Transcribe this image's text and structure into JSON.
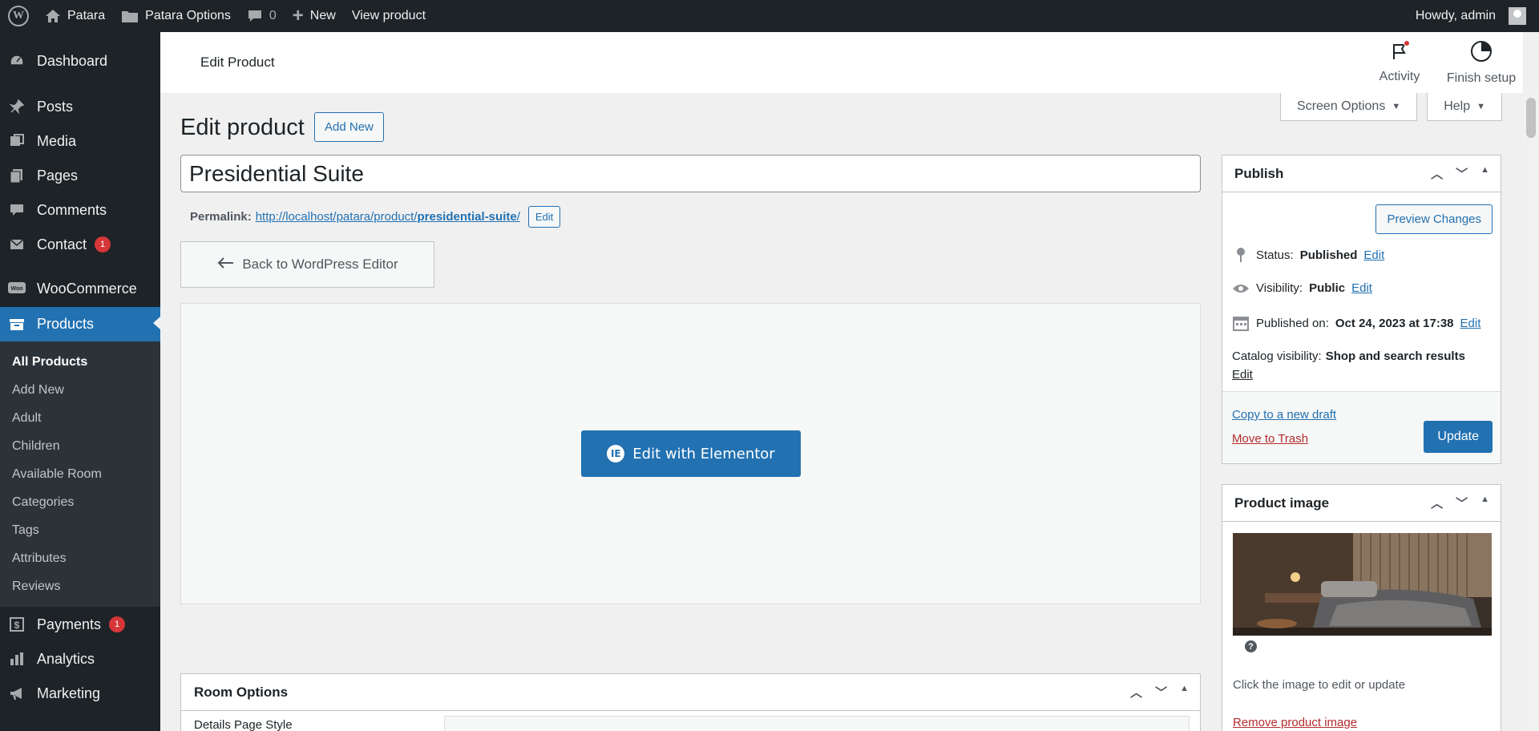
{
  "adminbar": {
    "site_name": "Patara",
    "options_label": "Patara Options",
    "comments_count": "0",
    "new_label": "New",
    "view_label": "View product",
    "howdy": "Howdy, admin"
  },
  "sidebar": {
    "items": [
      {
        "label": "Dashboard",
        "icon": "dashboard-icon"
      },
      {
        "label": "Posts",
        "icon": "pin-icon"
      },
      {
        "label": "Media",
        "icon": "media-icon"
      },
      {
        "label": "Pages",
        "icon": "pages-icon"
      },
      {
        "label": "Comments",
        "icon": "comment-icon"
      },
      {
        "label": "Contact",
        "icon": "mail-icon",
        "badge": "1"
      },
      {
        "label": "WooCommerce",
        "icon": "woo-icon"
      },
      {
        "label": "Products",
        "icon": "archive-icon"
      },
      {
        "label": "Payments",
        "icon": "dollar-icon",
        "badge": "1"
      },
      {
        "label": "Analytics",
        "icon": "chart-icon"
      },
      {
        "label": "Marketing",
        "icon": "megaphone-icon"
      }
    ],
    "submenu": [
      "All Products",
      "Add New",
      "Adult",
      "Children",
      "Available Room",
      "Categories",
      "Tags",
      "Attributes",
      "Reviews"
    ]
  },
  "header": {
    "title": "Edit Product",
    "activity": "Activity",
    "finish_setup": "Finish setup"
  },
  "screen_options": "Screen Options",
  "help": "Help",
  "main": {
    "page_title": "Edit product",
    "add_new": "Add New",
    "post_title": "Presidential Suite",
    "permalink_label": "Permalink:",
    "permalink_base": "http://localhost/patara/product/",
    "permalink_slug": "presidential-suite",
    "permalink_tail": "/",
    "permalink_edit": "Edit",
    "back_button": "Back to WordPress Editor",
    "elementor_button": "Edit with Elementor",
    "room_options_title": "Room Options",
    "room_row_label": "Details Page Style"
  },
  "publish": {
    "title": "Publish",
    "preview": "Preview Changes",
    "status_label": "Status:",
    "status_value": "Published",
    "visibility_label": "Visibility:",
    "visibility_value": "Public",
    "published_label": "Published on:",
    "published_value": "Oct 24, 2023 at 17:38",
    "catalog_label": "Catalog visibility:",
    "catalog_value": "Shop and search results",
    "edit": "Edit",
    "copy_draft": "Copy to a new draft",
    "trash": "Move to Trash",
    "update": "Update"
  },
  "product_image": {
    "title": "Product image",
    "hint": "Click the image to edit or update",
    "remove": "Remove product image"
  },
  "colors": {
    "admin_dark": "#1d2327",
    "accent": "#2271b1",
    "danger": "#d63638"
  }
}
